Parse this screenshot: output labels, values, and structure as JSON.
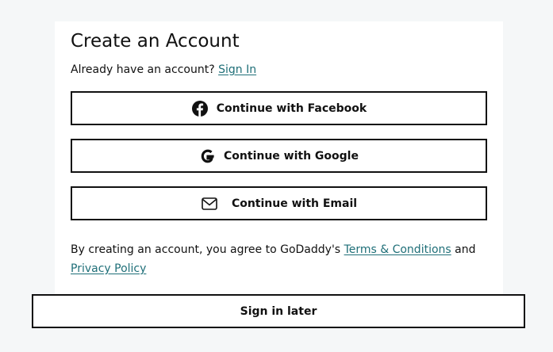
{
  "signup": {
    "title": "Create an Account",
    "already_text": "Already have an account?",
    "sign_in_link": "Sign In",
    "buttons": {
      "facebook": {
        "label": "Continue with Facebook",
        "icon": "facebook-icon"
      },
      "google": {
        "label": "Continue with Google",
        "icon": "google-icon"
      },
      "email": {
        "label": "Continue with Email",
        "icon": "mail-icon"
      }
    },
    "legal": {
      "prefix": "By creating an account, you agree to GoDaddy's",
      "terms_link": "Terms & Conditions",
      "conjunction": "and",
      "privacy_link": "Privacy Policy"
    }
  },
  "footer": {
    "sign_in_later_label": "Sign in later"
  },
  "colors": {
    "background": "#f5f7f8",
    "card": "#ffffff",
    "link": "#1f6f78",
    "border": "#111111"
  }
}
